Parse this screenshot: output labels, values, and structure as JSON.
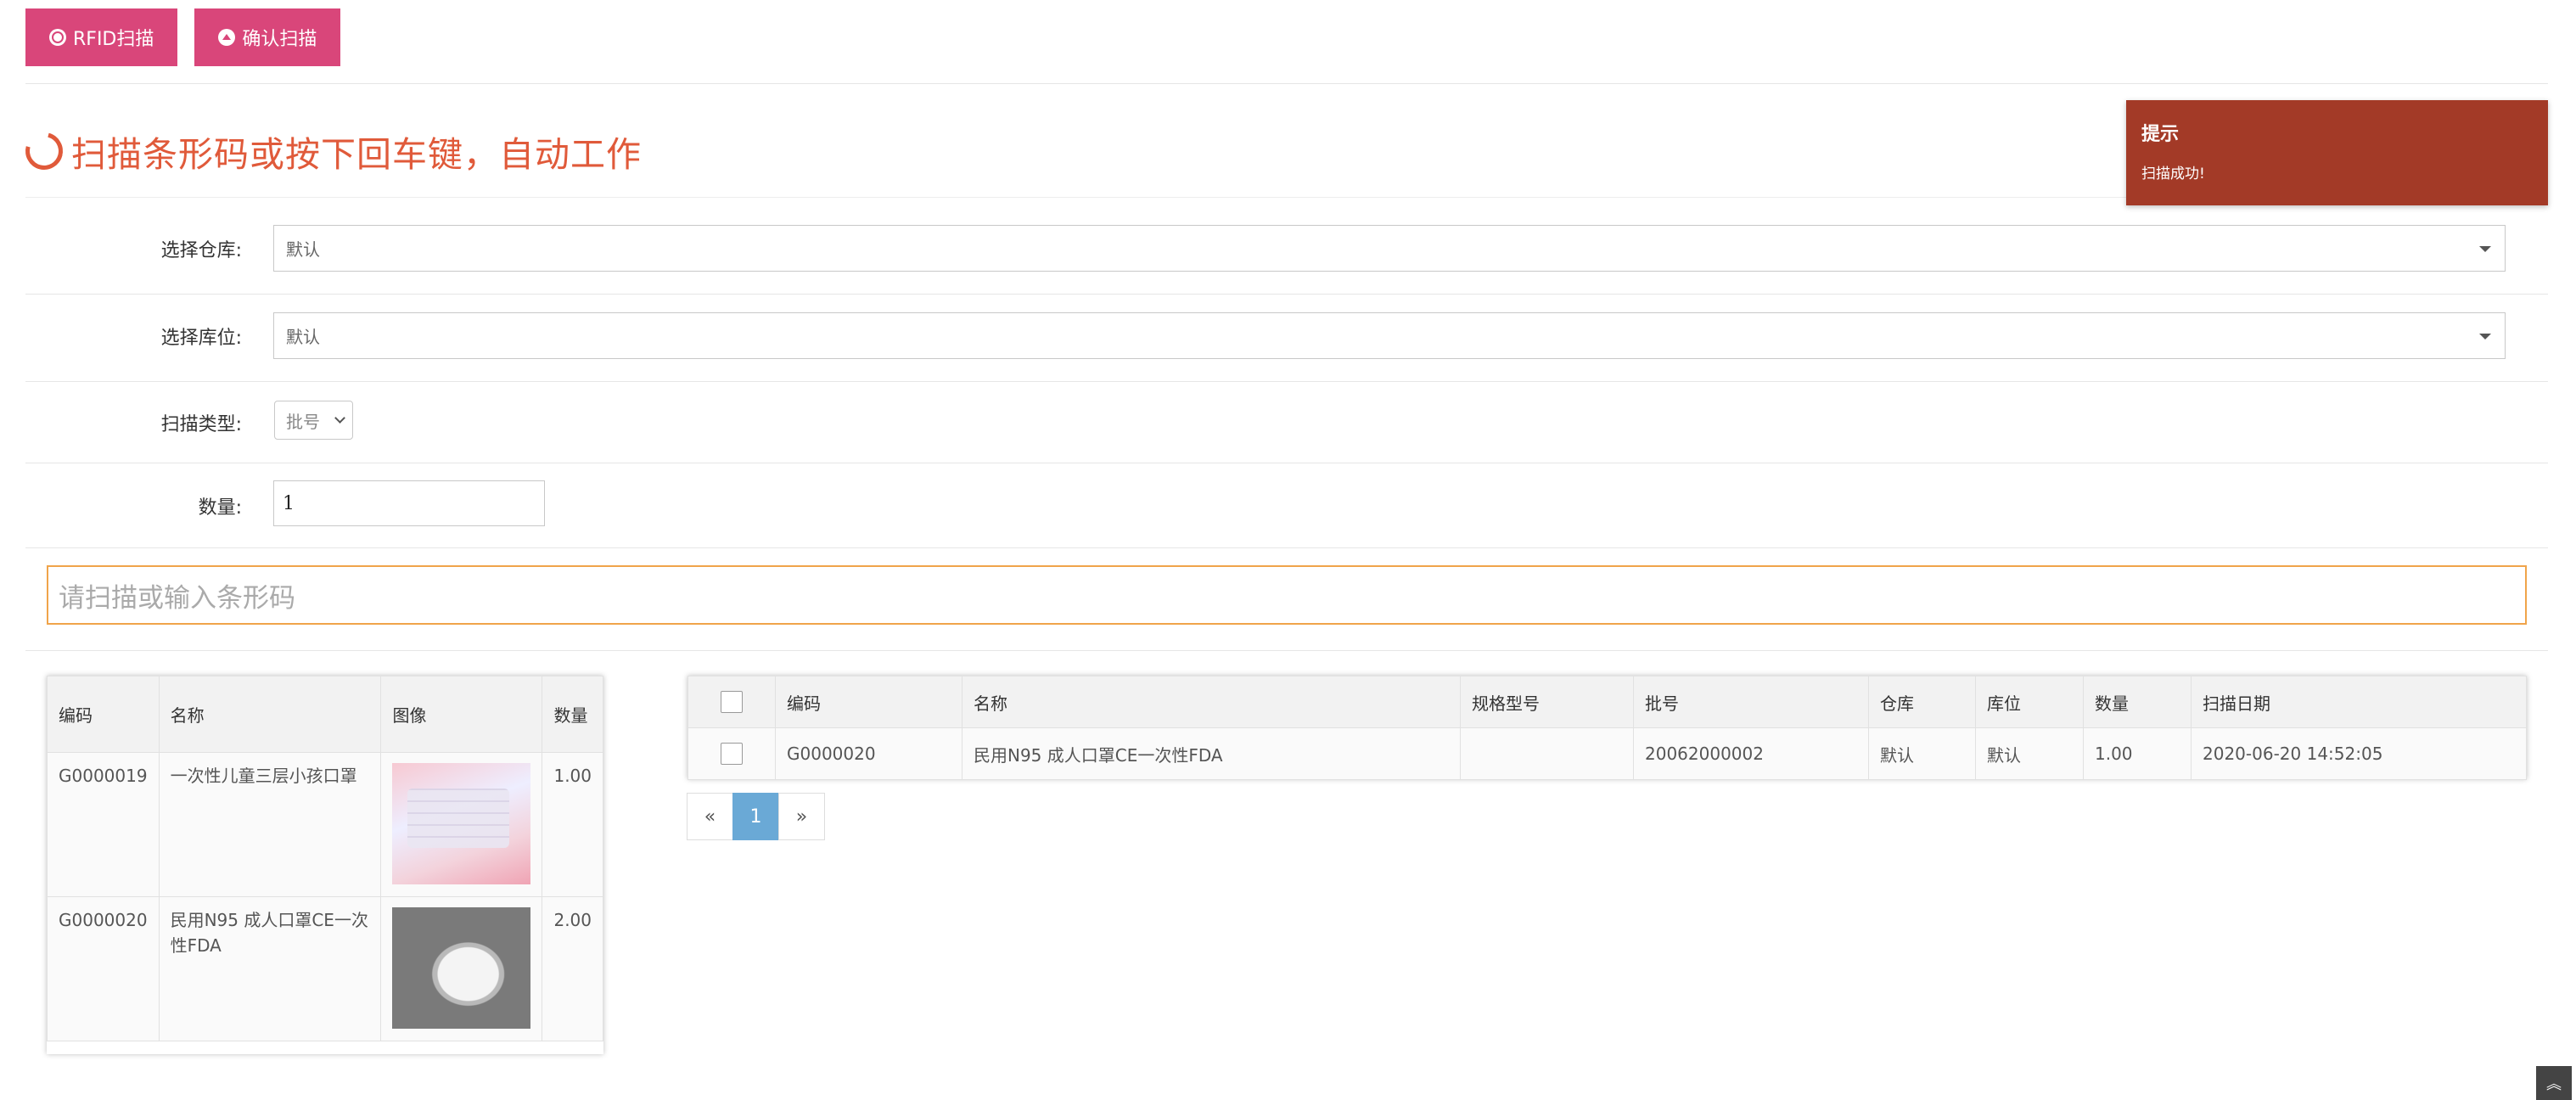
{
  "toolbar": {
    "rfid_label": "RFID扫描",
    "confirm_label": "确认扫描"
  },
  "heading": "扫描条形码或按下回车键，自动工作",
  "toast": {
    "title": "提示",
    "message": "扫描成功!"
  },
  "form": {
    "warehouse_label": "选择仓库:",
    "warehouse_value": "默认",
    "location_label": "选择库位:",
    "location_value": "默认",
    "scan_type_label": "扫描类型:",
    "scan_type_value": "批号",
    "quantity_label": "数量:",
    "quantity_value": "1",
    "barcode_placeholder": "请扫描或输入条形码"
  },
  "product_table": {
    "headers": [
      "编码",
      "名称",
      "图像",
      "数量"
    ],
    "rows": [
      {
        "code": "G0000019",
        "name": "一次性儿童三层小孩口罩",
        "image": "pink-kids-mask",
        "qty": "1.00"
      },
      {
        "code": "G0000020",
        "name": "民用N95 成人口罩CE一次性FDA",
        "image": "white-n95-mask",
        "qty": "2.00"
      }
    ]
  },
  "scan_table": {
    "headers": [
      "编码",
      "名称",
      "规格型号",
      "批号",
      "仓库",
      "库位",
      "数量",
      "扫描日期"
    ],
    "rows": [
      {
        "code": "G0000020",
        "name": "民用N95 成人口罩CE一次性FDA",
        "spec": "",
        "batch": "20062000002",
        "warehouse": "默认",
        "location": "默认",
        "qty": "1.00",
        "date": "2020-06-20 14:52:05"
      }
    ]
  },
  "pagination": {
    "prev": "«",
    "current": "1",
    "next": "»"
  },
  "colors": {
    "accent": "#d9467a",
    "heading": "#e05a3a",
    "toast": "#a33a27",
    "barcode_border": "#f0a44a",
    "page_active": "#6aa9d6"
  }
}
